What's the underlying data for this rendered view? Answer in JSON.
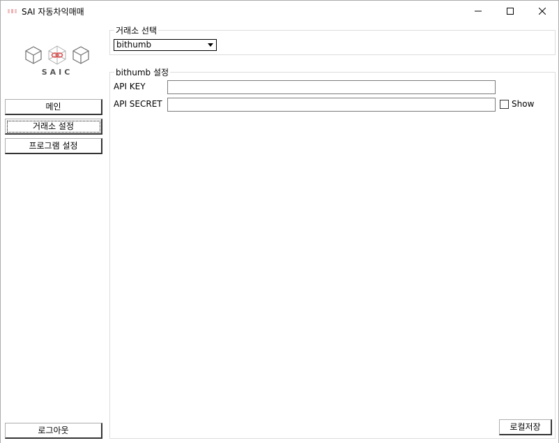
{
  "window": {
    "title": "SAI 자동차익매매",
    "controls": {
      "minimize": "minimize-icon",
      "maximize": "maximize-icon",
      "close": "close-icon"
    }
  },
  "sidebar": {
    "logo_text": "SAIC",
    "items": [
      {
        "label": "메인"
      },
      {
        "label": "거래소 설정"
      },
      {
        "label": "프로그램 설정"
      }
    ],
    "logout_label": "로그아웃"
  },
  "exchange_select": {
    "group_title": "거래소 선택",
    "selected": "bithumb"
  },
  "settings": {
    "group_title": "bithumb 설정",
    "api_key_label": "API KEY",
    "api_key_value": "",
    "api_secret_label": "API SECRET",
    "api_secret_value": "",
    "show_label": "Show",
    "show_checked": false,
    "save_label": "로컬저장"
  },
  "colors": {
    "logo_red": "#e05050",
    "logo_gray": "#6f6f6f",
    "group_border": "#dcdcdc"
  }
}
